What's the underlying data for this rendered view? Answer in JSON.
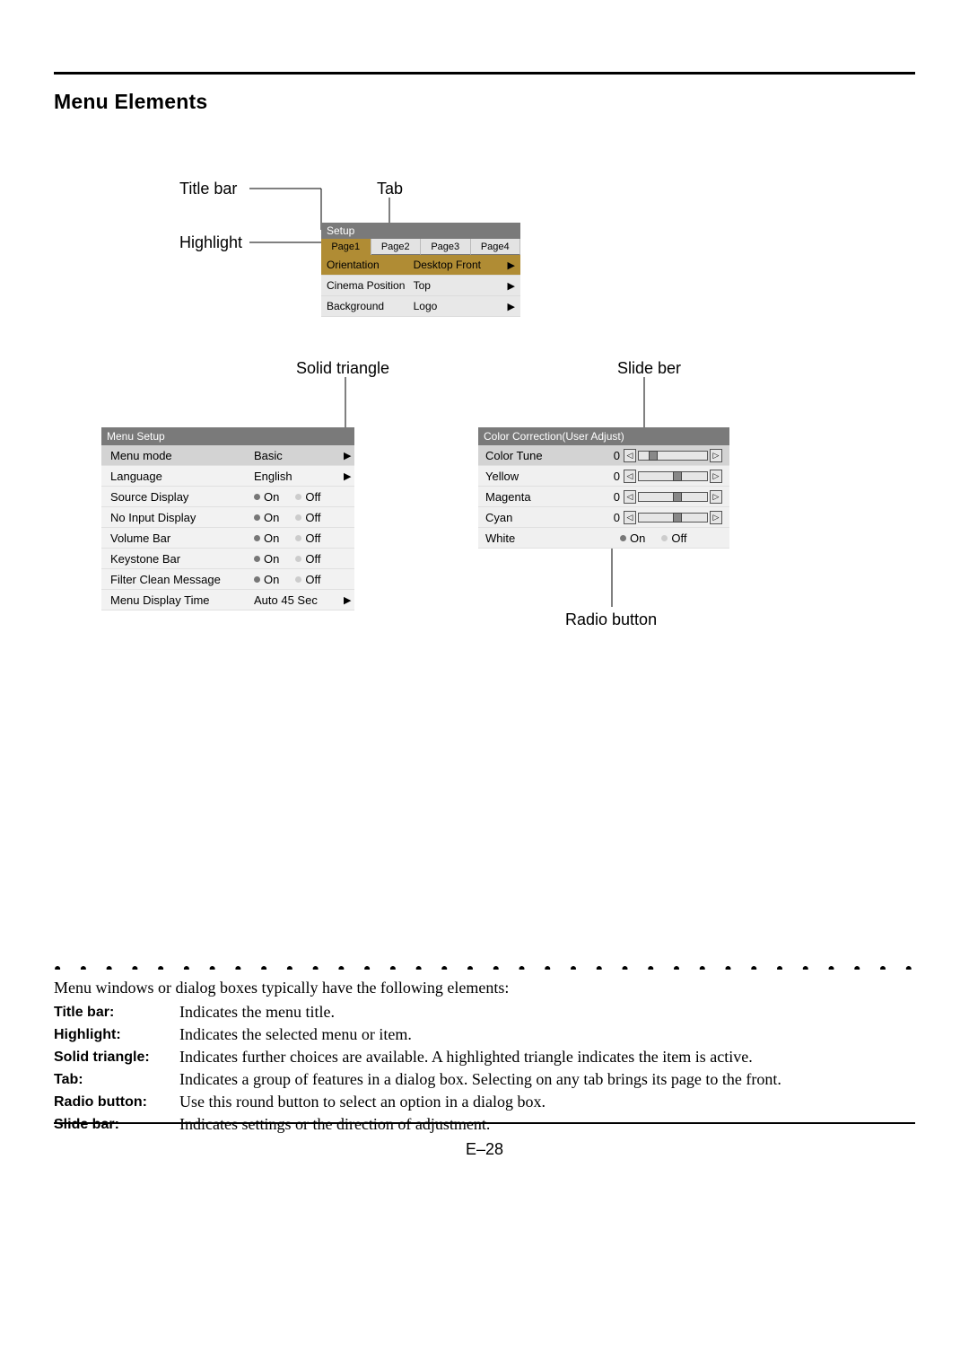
{
  "heading": "Menu Elements",
  "callouts": {
    "title_bar": "Title bar",
    "tab": "Tab",
    "highlight": "Highlight",
    "solid_triangle": "Solid triangle",
    "slide_bar": "Slide ber",
    "radio_button": "Radio button"
  },
  "setup_menu": {
    "title": "Setup",
    "tabs": [
      "Page1",
      "Page2",
      "Page3",
      "Page4"
    ],
    "rows": [
      {
        "label": "Orientation",
        "value": "Desktop Front"
      },
      {
        "label": "Cinema Position",
        "value": "Top"
      },
      {
        "label": "Background",
        "value": "Logo"
      }
    ]
  },
  "menu_setup": {
    "title": "Menu Setup",
    "rows": [
      {
        "label": "Menu mode",
        "value": "Basic",
        "type": "select",
        "highlight": true
      },
      {
        "label": "Language",
        "value": "English",
        "type": "select"
      },
      {
        "label": "Source Display",
        "type": "onoff",
        "selected": "On"
      },
      {
        "label": "No Input Display",
        "type": "onoff",
        "selected": "On"
      },
      {
        "label": "Volume Bar",
        "type": "onoff",
        "selected": "On"
      },
      {
        "label": "Keystone Bar",
        "type": "onoff",
        "selected": "On"
      },
      {
        "label": "Filter Clean Message",
        "type": "onoff",
        "selected": "On"
      },
      {
        "label": "Menu Display Time",
        "value": "Auto 45 Sec",
        "type": "select"
      }
    ],
    "on_label": "On",
    "off_label": "Off"
  },
  "color_correction": {
    "title": "Color Correction(User Adjust)",
    "rows": [
      {
        "label": "Color Tune",
        "value": 0,
        "type": "slider",
        "highlight": true,
        "thumb_pos": 0.15
      },
      {
        "label": "Yellow",
        "value": 0,
        "type": "slider",
        "thumb_pos": 0.5
      },
      {
        "label": "Magenta",
        "value": 0,
        "type": "slider",
        "thumb_pos": 0.5
      },
      {
        "label": "Cyan",
        "value": 0,
        "type": "slider",
        "thumb_pos": 0.5
      },
      {
        "label": "White",
        "type": "onoff",
        "selected": "On"
      }
    ],
    "on_label": "On",
    "off_label": "Off"
  },
  "descriptions": {
    "intro": "Menu windows or dialog boxes typically have the following elements:",
    "items": [
      {
        "term": "Title bar:",
        "def": "Indicates the menu title."
      },
      {
        "term": "Highlight:",
        "def": "Indicates the selected menu or item."
      },
      {
        "term": "Solid triangle:",
        "def": "Indicates further choices are available. A highlighted triangle indicates the item is active."
      },
      {
        "term": "Tab:",
        "def": "Indicates a group of features in a dialog box. Selecting on any tab brings its page to the front."
      },
      {
        "term": "Radio button:",
        "def": "Use this round button to select an option in a dialog box."
      },
      {
        "term": "Slide bar:",
        "def": "Indicates settings or the direction of adjustment."
      }
    ]
  },
  "page_number": "E–28"
}
